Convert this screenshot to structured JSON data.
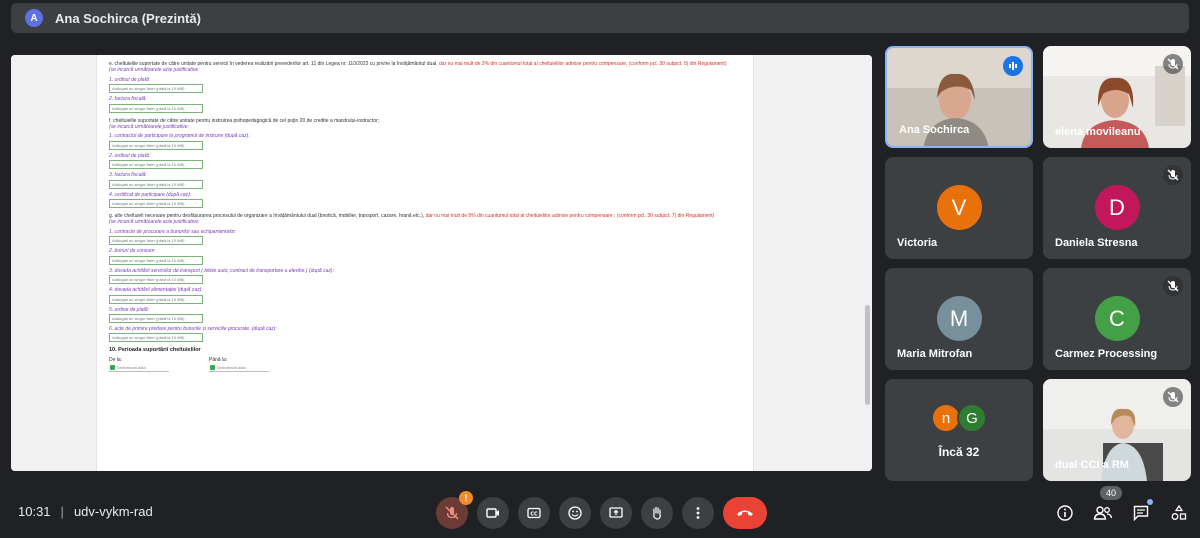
{
  "presenter": {
    "initial": "A",
    "label": "Ana Sochirca (Prezintă)"
  },
  "document": {
    "items": [
      {
        "heading": "e. cheltuielile suportate de către unitate pentru servicii în vederea realizării prevederilor art. 11 din Legea nr. 110/2022 cu privire la învățământul dual,",
        "heading_red": " dar nu mai mult de 3% din cuantumul total al cheltuielilor admise pentru compensare; (conform pct. 30 subpct. 5) din Regulament)",
        "intro": "(se incarcă următoarele acte justificative:",
        "fields": [
          "1. ordinul de plată:",
          "2. factura fiscală:"
        ]
      },
      {
        "heading": "f. cheltuielile suportate de către unitate pentru instruirea psihopedagogică de cel puțin 20 de credite a maistrului-instructor;",
        "heading_red": "",
        "intro": "(se incarcă următoarele justificative:",
        "fields": [
          "1. contractul de participare la programul de instruire (după caz):",
          "2. ordinul de plată:",
          "3. factura fiscală:",
          "4. certificat de participare (după caz):"
        ]
      },
      {
        "heading": "g. alte cheltuieli necesare pentru desfășurarea procesului de organizare a învățământului dual (birotică, mobilier, transport, cazare, hrană etc.),",
        "heading_red": " dar nu mai mult de 5% din cuantumul total al cheltuielilor admise pentru compensare ; (conform pct. 30 subpct. 7) din Regulament)",
        "intro": "(se incarcă următoarele acte justificative:",
        "fields": [
          "1. contracte de procurare a bunurilor sau echipamentelor:",
          "2. bonuri de consum:",
          "3. dovada achitării serviciilor de transport ( bilete auto, contract de transportare a elevilor.) (după caz):",
          "4. dovada achitării alimentației (după caz):",
          "5. ordine de plată:",
          "6. acte de primire predare pentru bunurile și serviciile procurate. (după caz):"
        ]
      }
    ],
    "upload_label": "Adăugați un singur fișier (până la 10 MB)",
    "section_title": "10. Perioada suportării cheltuielilor",
    "from_label": "De la:",
    "to_label": "Până la:",
    "date_placeholder": "Selectează data"
  },
  "participants": [
    {
      "name": "Ana Sochirca",
      "type": "video",
      "speaking": true
    },
    {
      "name": "elena movileanu",
      "type": "video",
      "muted": true
    },
    {
      "name": "Victoria",
      "type": "avatar",
      "initial": "V",
      "color": "#e8710a",
      "muted": false
    },
    {
      "name": "Daniela Stresna",
      "type": "avatar",
      "initial": "D",
      "color": "#c2185b",
      "muted": true
    },
    {
      "name": "Maria Mitrofan",
      "type": "avatar",
      "initial": "M",
      "color": "#78909c",
      "muted": false
    },
    {
      "name": "Carmez Processing",
      "type": "avatar",
      "initial": "C",
      "color": "#43a047",
      "muted": true
    },
    {
      "name": "dual CCI a RM",
      "type": "video",
      "muted": true
    }
  ],
  "more_tile": {
    "label": "Încă 32",
    "initials": [
      "n",
      "G"
    ],
    "colors": [
      "#e8710a",
      "#2e7d32"
    ]
  },
  "bottom_bar": {
    "time": "10:31",
    "meeting_code": "udv-vykm-rad",
    "mic_warning": "!",
    "people_count": "40",
    "controls": [
      "mic-off-icon",
      "camera-icon",
      "captions-icon",
      "emoji-icon",
      "present-icon",
      "raise-hand-icon",
      "more-options-icon",
      "end-call-icon"
    ],
    "right_controls": [
      "info-icon",
      "people-icon",
      "chat-icon",
      "activities-icon"
    ]
  }
}
